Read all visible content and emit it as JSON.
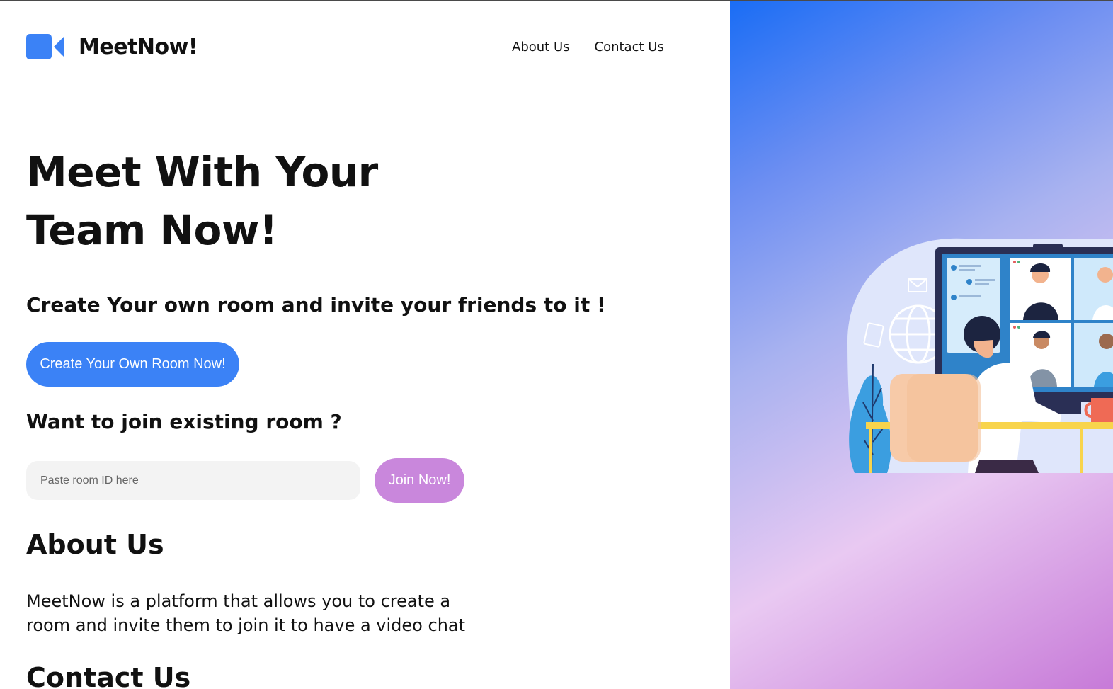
{
  "brand": {
    "name": "MeetNow!",
    "icon": "video-camera-icon",
    "color": "#3b82f6"
  },
  "nav": {
    "about": "About Us",
    "contact": "Contact Us"
  },
  "hero": {
    "title": "Meet With Your Team Now!",
    "subtitle": "Create Your own room and invite your friends to it !",
    "create_button": "Create Your Own Room Now!"
  },
  "join": {
    "label": "Want to join existing room ?",
    "input_placeholder": "Paste room ID here",
    "input_value": "",
    "button": "Join Now!",
    "button_color": "#c987dc"
  },
  "about": {
    "heading": "About Us",
    "text": "MeetNow is a platform that allows you to create a room and invite them to join it to have a video chat"
  },
  "contact": {
    "heading": "Contact Us"
  },
  "illustration": {
    "subject": "video-conference-illustration"
  }
}
